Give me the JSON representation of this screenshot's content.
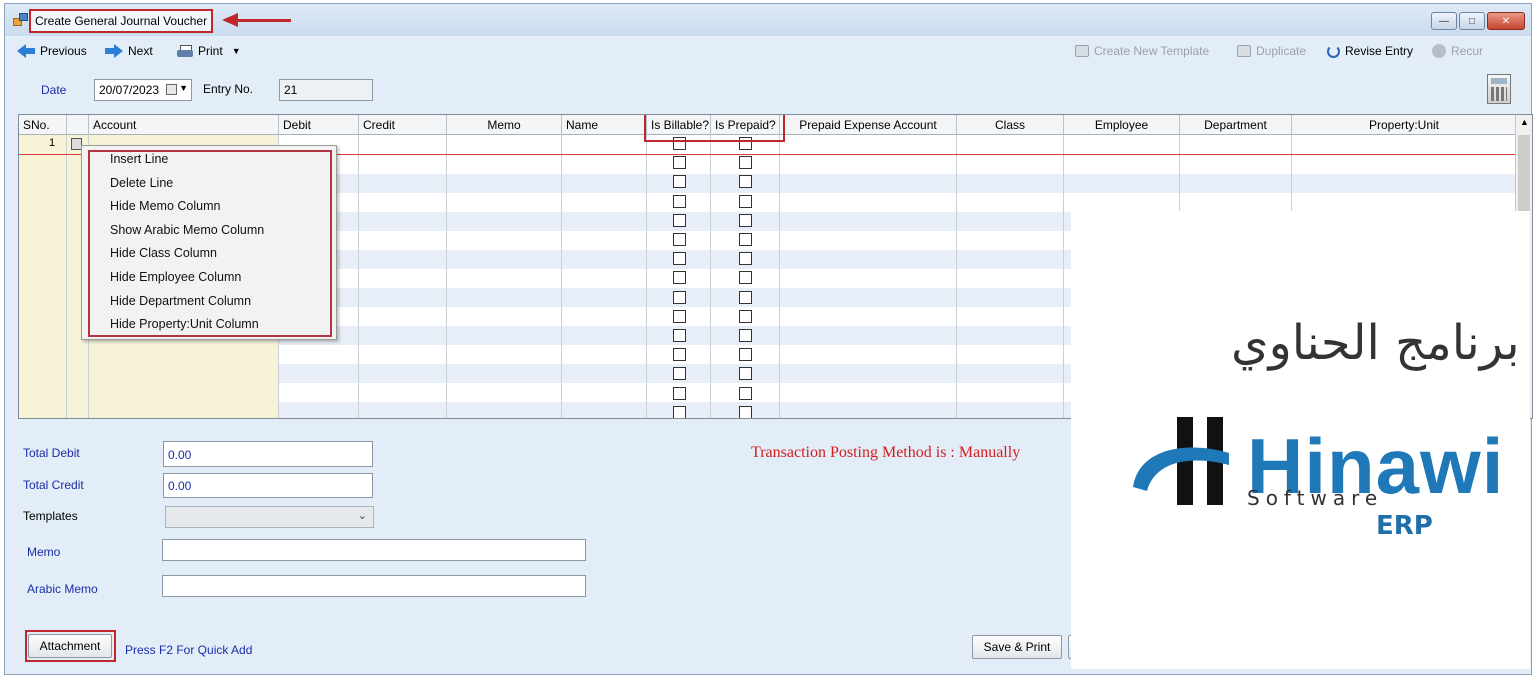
{
  "window": {
    "title": "Create General Journal Voucher",
    "controls": [
      "minimize",
      "maximize",
      "close"
    ]
  },
  "toolbar": {
    "previous": "Previous",
    "next": "Next",
    "print": "Print",
    "create_template": "Create New Template",
    "duplicate": "Duplicate",
    "revise_entry": "Revise Entry",
    "recur": "Recur"
  },
  "header": {
    "date_label": "Date",
    "date_value": "20/07/2023",
    "entry_label": "Entry No.",
    "entry_value": "21"
  },
  "grid": {
    "columns": [
      "SNo.",
      "",
      "Account",
      "Debit",
      "Credit",
      "Memo",
      "Name",
      "Is Billable?",
      "Is Prepaid?",
      "Prepaid Expense Account",
      "Class",
      "Employee",
      "Department",
      "Property:Unit"
    ],
    "first_row_sno": "1",
    "visible_checkbox_rows": 15
  },
  "context_menu": {
    "items": [
      "Insert Line",
      "Delete Line",
      "Hide Memo Column",
      "Show Arabic Memo Column",
      "Hide Class Column",
      "Hide Employee Column",
      "Hide Department Column",
      "Hide Property:Unit Column"
    ]
  },
  "footer": {
    "total_debit_label": "Total Debit",
    "total_debit_value": "0.00",
    "total_credit_label": "Total Credit",
    "total_credit_value": "0.00",
    "templates_label": "Templates",
    "memo_label": "Memo",
    "arabic_memo_label": "Arabic Memo",
    "posting_method": "Transaction Posting Method is : Manually",
    "attachment": "Attachment",
    "quick_add": "Press F2 For Quick Add",
    "save_print": "Save & Print"
  },
  "logo": {
    "arabic": "برنامج الحناوي",
    "name": "Hinawi",
    "sub": "Software",
    "erp": "ERP"
  },
  "colors": {
    "highlight_red": "#c0272d",
    "label_blue": "#1a2ea8",
    "window_bg": "#e3edf7",
    "posting_red": "#d11f1f",
    "logo_blue": "#1f79b8"
  }
}
